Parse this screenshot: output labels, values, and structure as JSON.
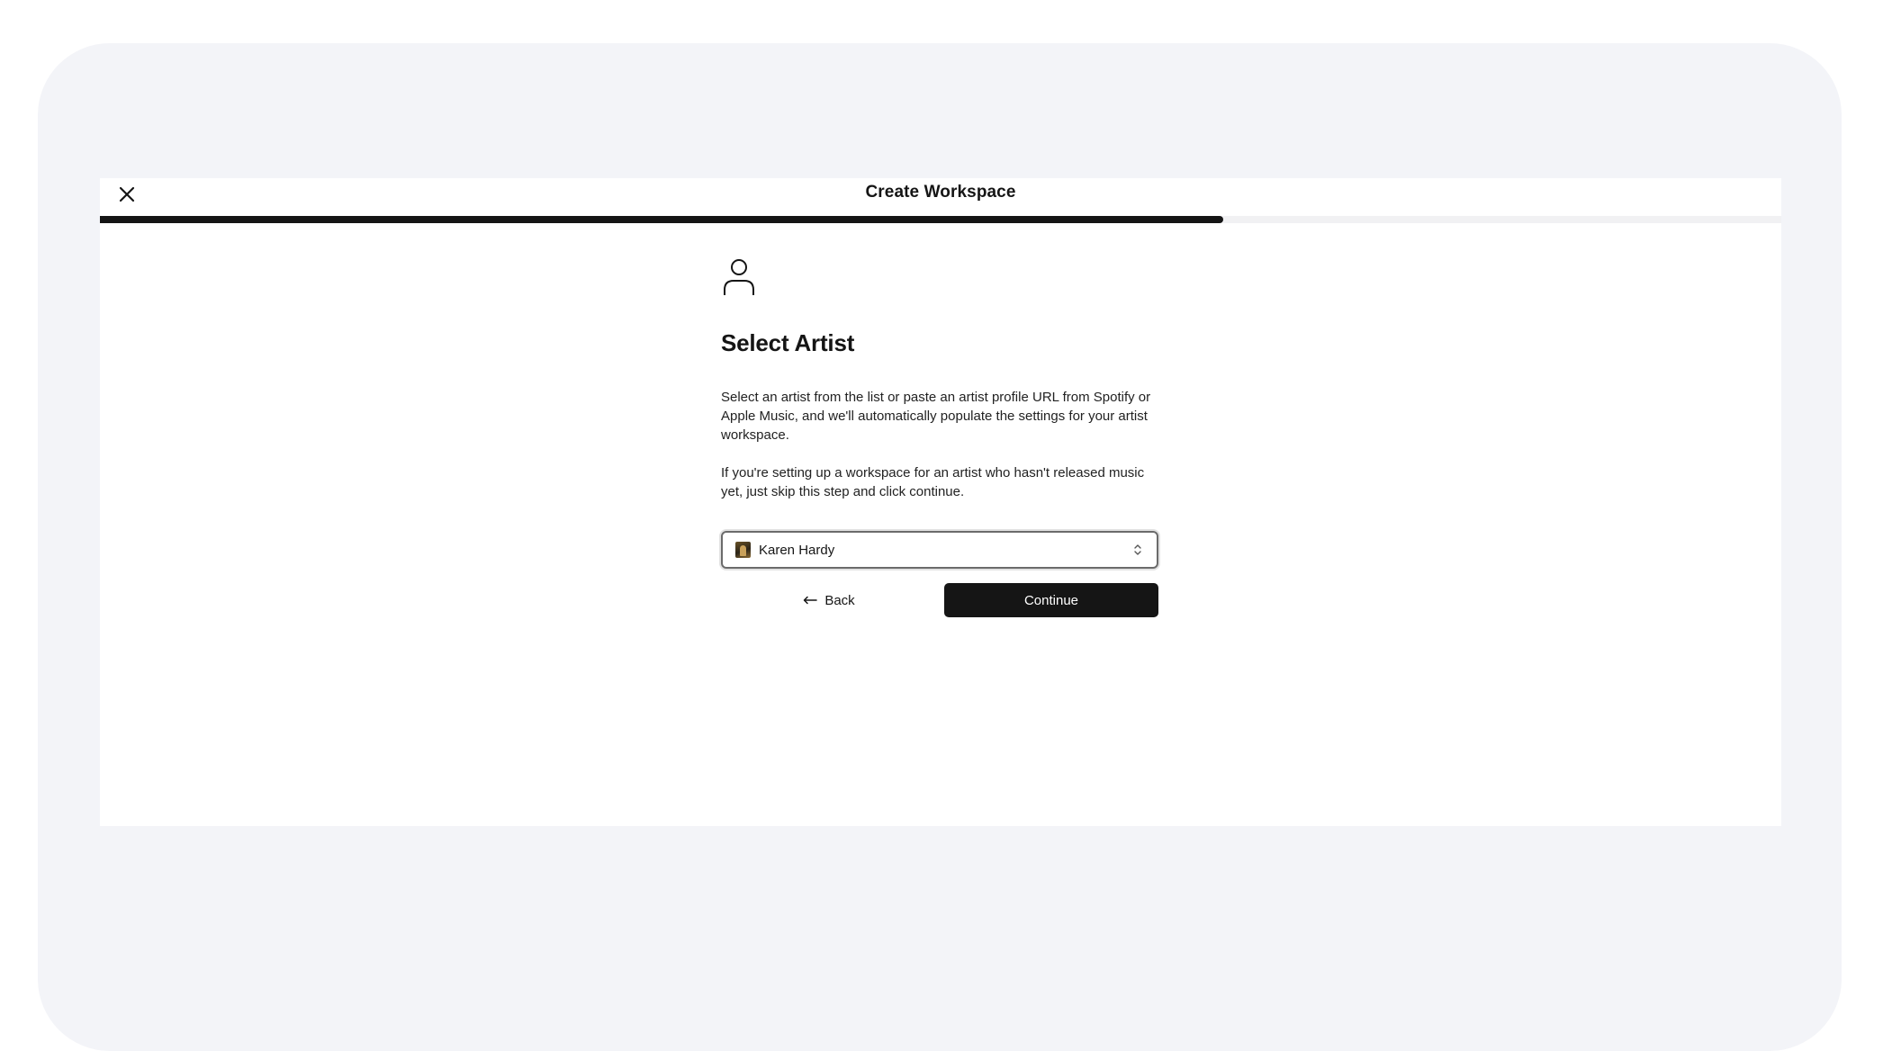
{
  "header": {
    "title": "Create Workspace",
    "close_icon": "close-icon"
  },
  "progress": {
    "fraction": 0.668
  },
  "step": {
    "icon": "user-icon",
    "heading": "Select Artist",
    "paragraph_1": "Select an artist from the list or paste an artist profile URL from Spotify or Apple Music, and we'll automatically populate the settings for your artist workspace.",
    "paragraph_2": "If you're setting up a workspace for an artist who hasn't released music yet, just skip this step and click continue."
  },
  "artist_select": {
    "selected_value": "Karen Hardy",
    "icon": "chevron-up-down-icon"
  },
  "actions": {
    "back_label": "Back",
    "continue_label": "Continue"
  },
  "colors": {
    "device_background": "#f3f4f8",
    "primary": "#151515",
    "progress_track": "#f1f1f3"
  }
}
